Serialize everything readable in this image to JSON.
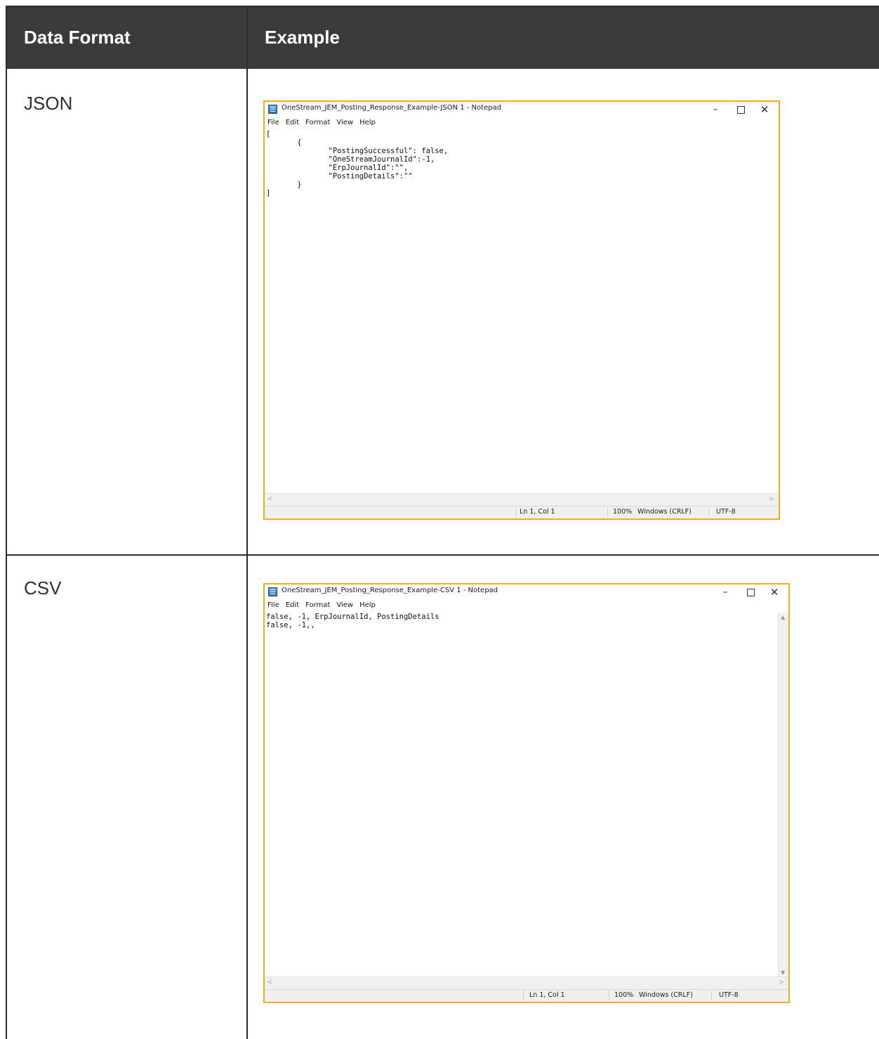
{
  "table": {
    "header": {
      "col1": "Data Format",
      "col2": "Example"
    },
    "rows": [
      {
        "format": "JSON",
        "notepad": {
          "title": "OneStream_JEM_Posting_Response_Example-JSON 1 - Notepad",
          "menu": [
            "File",
            "Edit",
            "Format",
            "View",
            "Help"
          ],
          "content": "[\n\t{\n\t\t\"PostingSuccessful\": false,\n\t\t\"OneStreamJournalId\":-1,\n\t\t\"ErpJournalId\":\"\",\n\t\t\"PostingDetails\":\"\"\n\t}\n]",
          "status": {
            "position": "Ln 1, Col 1",
            "zoom": "100%",
            "line_ending": "Windows (CRLF)",
            "encoding": "UTF-8"
          }
        }
      },
      {
        "format": "CSV",
        "notepad": {
          "title": "OneStream_JEM_Posting_Response_Example-CSV 1 - Notepad",
          "menu": [
            "File",
            "Edit",
            "Format",
            "View",
            "Help"
          ],
          "content": "false, -1, ErpJournalId, PostingDetails\nfalse, -1,,",
          "status": {
            "position": "Ln 1, Col 1",
            "zoom": "100%",
            "line_ending": "Windows (CRLF)",
            "encoding": "UTF-8"
          }
        }
      }
    ]
  },
  "icons": {
    "window_controls": [
      "minimize-icon",
      "maximize-icon",
      "close-icon"
    ],
    "app": "notepad-icon"
  },
  "colors": {
    "header_bg": "#3b3b3b",
    "header_text": "#ffffff",
    "window_border": "#f2ad1a"
  }
}
